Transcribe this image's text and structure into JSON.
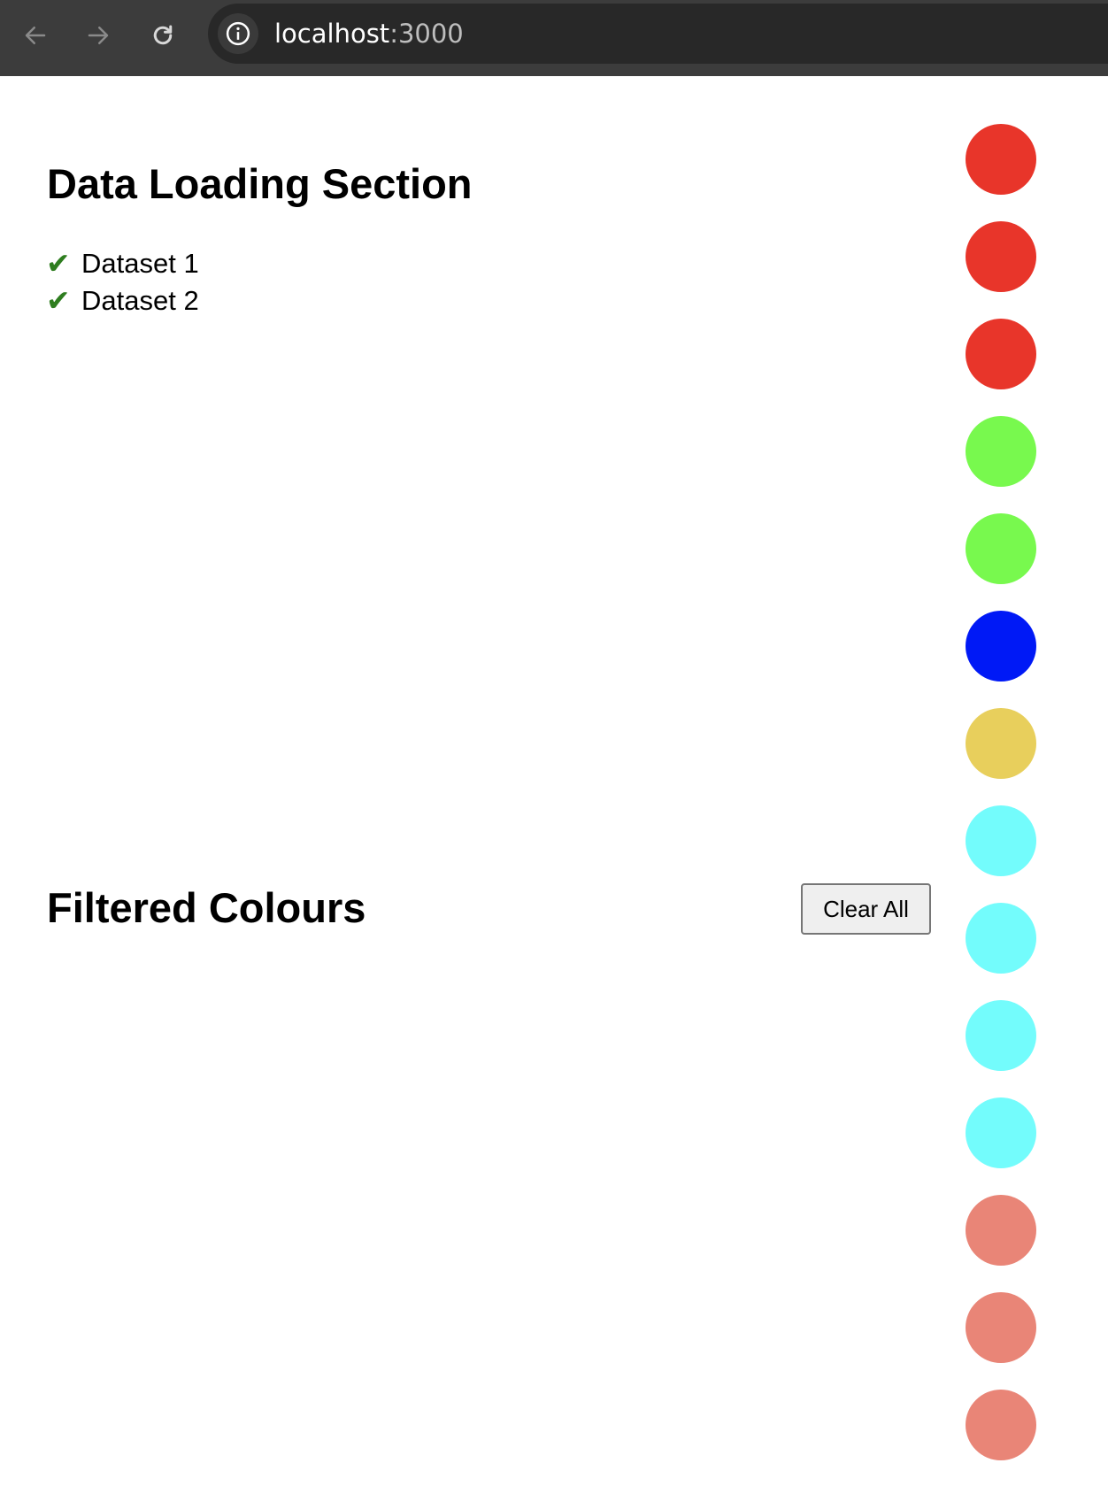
{
  "browser": {
    "url_host": "localhost",
    "url_port": ":3000"
  },
  "data_section": {
    "title": "Data Loading Section",
    "check_symbol": "✔",
    "datasets": [
      "Dataset 1",
      "Dataset 2"
    ]
  },
  "filtered_section": {
    "title": "Filtered Colours",
    "clear_label": "Clear All"
  },
  "swatches": [
    "#e8352a",
    "#e8352a",
    "#e8352a",
    "#78f94e",
    "#78f94e",
    "#0019f6",
    "#e8cf5c",
    "#73fcfc",
    "#73fcfc",
    "#73fcfc",
    "#73fcfc",
    "#e98577",
    "#e98577",
    "#e98577"
  ]
}
